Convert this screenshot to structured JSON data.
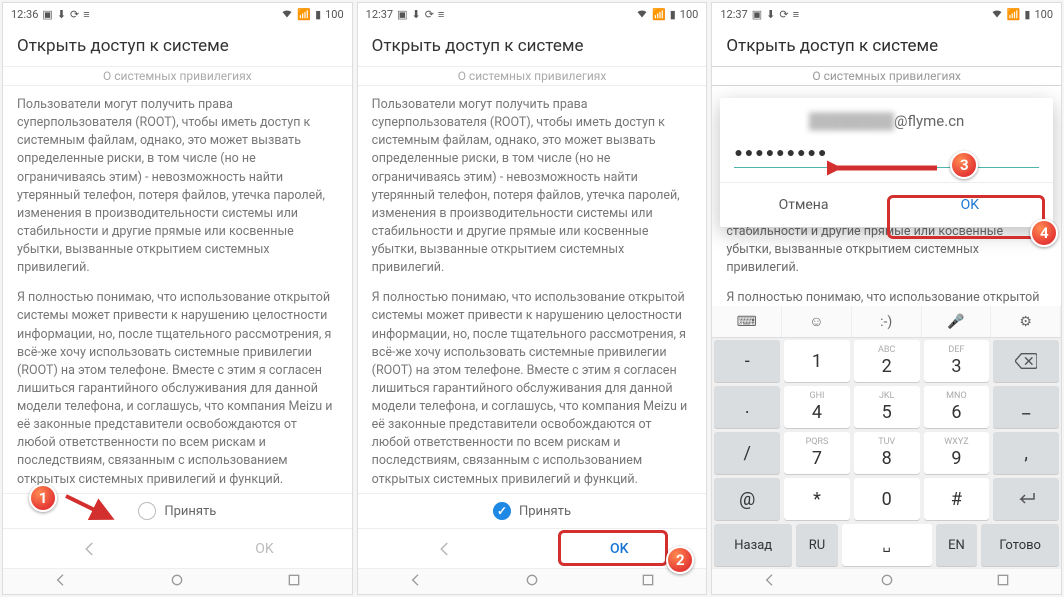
{
  "statusbar": {
    "time_a": "12:36",
    "time_b": "12:37",
    "battery": "100"
  },
  "header": {
    "title": "Открыть доступ к системе",
    "subtitle": "О системных привилегиях"
  },
  "body": {
    "p1": "Пользователи могут получить права суперпользователя (ROOT), чтобы иметь доступ к системным файлам, однако, это может вызвать определенные риски, в том числе (но не ограничиваясь этим) - невозможность найти утерянный телефон, потеря файлов, утечка паролей, изменения в производительности системы или стабильности и другие прямые или косвенные убытки, вызванные открытием системных привилегий.",
    "p2": "Я полностью понимаю, что использование открытой системы может привести к нарушению целостности информации, но, после тщательного рассмотрения, я всё-же хочу использовать системные привилегии (ROOT) на этом телефоне. Вместе с этим я согласен лишиться гарантийного обслуживания для данной модели телефона, и соглашусь, что компания Meizu и её законные представители освобождаются от любой ответственности по всем рискам и последствиям, связанным с использованием открытых системных привилегий и функций."
  },
  "accept": {
    "label": "Принять"
  },
  "buttons": {
    "ok": "OK"
  },
  "dialog": {
    "account_domain": "@flyme.cn",
    "password_mask": "●●●●●●●●●",
    "cancel": "Отмена",
    "ok": "OK"
  },
  "keyboard": {
    "rows": [
      [
        {
          "sub": "",
          "main": "-"
        },
        {
          "sub": "",
          "main": "1"
        },
        {
          "sub": "ABC",
          "main": "2"
        },
        {
          "sub": "DEF",
          "main": "3"
        },
        {
          "icon": "backspace"
        }
      ],
      [
        {
          "sub": "",
          "main": "."
        },
        {
          "sub": "GHI",
          "main": "4"
        },
        {
          "sub": "JKL",
          "main": "5"
        },
        {
          "sub": "MNO",
          "main": "6"
        },
        {
          "sub": "",
          "main": "_"
        }
      ],
      [
        {
          "sub": "",
          "main": "/"
        },
        {
          "sub": "PQRS",
          "main": "7"
        },
        {
          "sub": "TUV",
          "main": "8"
        },
        {
          "sub": "WXYZ",
          "main": "9"
        },
        {
          "sub": "",
          "main": ","
        }
      ],
      [
        {
          "sub": "",
          "main": "@"
        },
        {
          "sub": "",
          "main": "*"
        },
        {
          "sub": "",
          "main": "0"
        },
        {
          "sub": "",
          "main": "#"
        },
        {
          "icon": "return"
        }
      ]
    ],
    "bottom": {
      "back": "Назад",
      "ru": "RU",
      "space": "␣",
      "en": "EN",
      "done": "Готово"
    },
    "top_icons": [
      "keyboard",
      "emoji",
      "text",
      "mic",
      "gear"
    ],
    "top_text": ":-)"
  },
  "steps": {
    "s1": "1",
    "s2": "2",
    "s3": "3",
    "s4": "4"
  }
}
